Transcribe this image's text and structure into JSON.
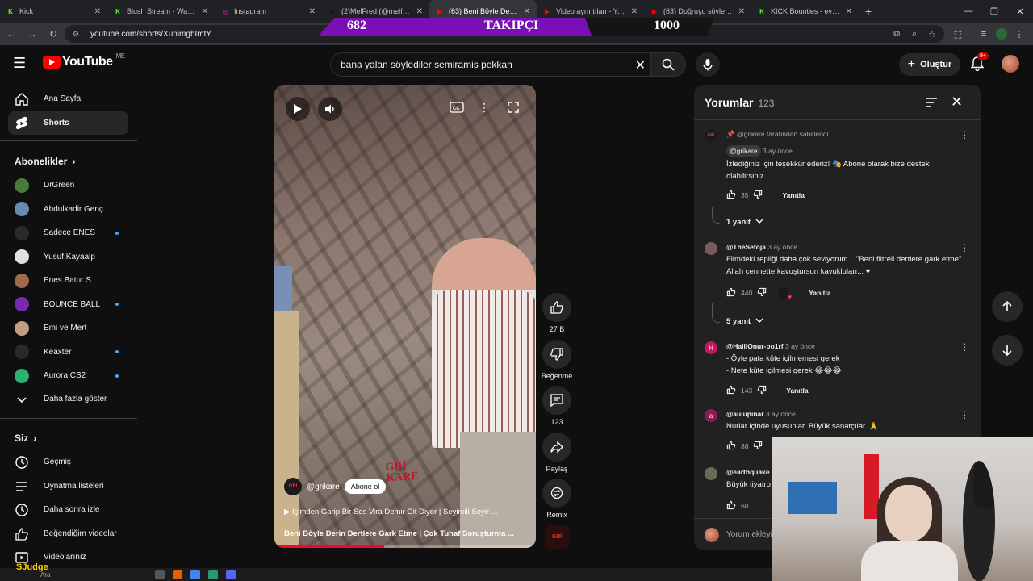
{
  "browser": {
    "tabs": [
      {
        "title": "Kick",
        "favicon_color": "#53fc18",
        "favicon_glyph": "K"
      },
      {
        "title": "Blush Stream - Watch Live",
        "favicon_color": "#53fc18",
        "favicon_glyph": "K"
      },
      {
        "title": "Instagram",
        "favicon_color": "#d6249f",
        "favicon_glyph": "◎"
      },
      {
        "title": "(2)MelFred (@melfred.2...",
        "favicon_color": "#000000",
        "favicon_glyph": "♪"
      },
      {
        "title": "(63) Beni Böyle Derin De...",
        "favicon_color": "#ff0000",
        "favicon_glyph": "▶",
        "active": true
      },
      {
        "title": "Video ayrıntıları - YouTube",
        "favicon_color": "#ff0000",
        "favicon_glyph": "▶"
      },
      {
        "title": "(63) Doğruyu söylemek...",
        "favicon_color": "#ff0000",
        "favicon_glyph": "▶"
      },
      {
        "title": "KICK Bounties - every pl...",
        "favicon_color": "#53fc18",
        "favicon_glyph": "K"
      }
    ],
    "url": "youtube.com/shorts/XunimgbImtY"
  },
  "overlay": {
    "left_number": "682",
    "label": "TAKIPÇI",
    "right_number": "1000"
  },
  "header": {
    "logo_text": "YouTube",
    "logo_country": "ME",
    "search_value": "bana yalan söylediler semiramis pekkan",
    "create_label": "Oluştur",
    "notification_badge": "9+"
  },
  "sidebar": {
    "main": [
      {
        "label": "Ana Sayfa",
        "icon": "home-icon"
      },
      {
        "label": "Shorts",
        "icon": "shorts-icon",
        "active": true
      }
    ],
    "subs_title": "Abonelikler",
    "subs": [
      {
        "label": "DrGreen",
        "color": "#4a7a3a",
        "dot": false
      },
      {
        "label": "Abdulkadir Genç",
        "color": "#6a8ab0",
        "dot": false
      },
      {
        "label": "Sadece ENES",
        "color": "#2a2a2a",
        "dot": true
      },
      {
        "label": "Yusuf Kayaalp",
        "color": "#e0e0e0",
        "dot": false
      },
      {
        "label": "Enes Batur S",
        "color": "#a06a4a",
        "dot": false
      },
      {
        "label": "BOUNCE BALL",
        "color": "#7a2ab0",
        "dot": true
      },
      {
        "label": "Emi ve Mert",
        "color": "#c0a080",
        "dot": false
      },
      {
        "label": "Keaxter",
        "color": "#2a2a2a",
        "dot": true
      },
      {
        "label": "Aurora CS2",
        "color": "#2ab070",
        "dot": true
      }
    ],
    "more_label": "Daha fazla göster",
    "you_title": "Siz",
    "you": [
      {
        "label": "Geçmiş",
        "icon": "history-icon"
      },
      {
        "label": "Oynatma listeleri",
        "icon": "playlist-icon"
      },
      {
        "label": "Daha sonra izle",
        "icon": "clock-icon"
      },
      {
        "label": "Beğendiğim videolar",
        "icon": "like-icon"
      },
      {
        "label": "Videolarınız",
        "icon": "video-icon"
      }
    ]
  },
  "video": {
    "channel": "@grikare",
    "subscribe_label": "Abone ol",
    "line1": "▶ İçimden Garip Bir Ses Vira Demir Git Diyor | Seyircili Seyir ...",
    "line2": "Beni Böyle Derin Dertlere Gark Etme | Çok Tuhaf Soruşturma ...",
    "watermark_line1": "GRİ",
    "watermark_line2": "KARE",
    "progress": 0.42
  },
  "actions": {
    "like_count": "27 B",
    "dislike_label": "Beğenme",
    "comment_count": "123",
    "share_label": "Paylaş",
    "remix_label": "Remix"
  },
  "comments": {
    "title": "Yorumlar",
    "count": "123",
    "input_placeholder": "Yorum ekleyin...",
    "items": [
      {
        "pinned_by": "@grikare tarafından sabitlendi",
        "author": "@grikare",
        "time": "3 ay önce",
        "text": "İzlediğiniz için teşekkür ederiz! 🎭 Abone olarak bize destek olabilirsiniz.",
        "likes": "35",
        "reply_label": "Yanıtla",
        "replies": "1 yanıt",
        "avatar_color": "#1a1a1a"
      },
      {
        "author": "@TheSefoja",
        "time": "3 ay önce",
        "text": "Filmdeki repliği daha çok seviyorum... \"Beni filtreli dertlere gark etme\" Allah cennette kavuştursun kavukluları... ♥",
        "likes": "440",
        "reply_label": "Yanıtla",
        "replies": "5 yanıt",
        "avatar_color": "#7a5a5a"
      },
      {
        "author": "@HalilOnur-po1rf",
        "time": "3 ay önce",
        "text": "- Öyle pata küte içilmemesi gerek\n- Nete küte içilmesi gerek 😂😂😂",
        "likes": "143",
        "reply_label": "Yanıtla",
        "avatar_color": "#c2185b",
        "avatar_letter": "H"
      },
      {
        "author": "@aulupinar",
        "time": "3 ay önce",
        "text": "Nurlar içinde uyusunlar. Büyük sanatçılar. 🙏",
        "likes": "88",
        "avatar_color": "#8e1a5a",
        "avatar_letter": "a"
      },
      {
        "author": "@earthquake",
        "time": "",
        "text": "Büyük tiyatro",
        "likes": "60",
        "avatar_color": "#6a6a5a"
      }
    ]
  },
  "streamer": {
    "name": "SJudge"
  },
  "taskbar": {
    "search_label": "Ara"
  }
}
